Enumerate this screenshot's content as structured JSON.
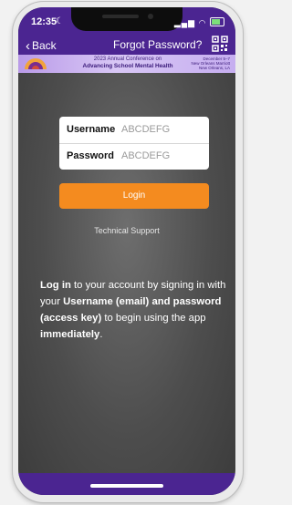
{
  "status_bar": {
    "time": "12:35",
    "moon": "☾",
    "signal": "▂▄▆",
    "wifi": "◠"
  },
  "nav": {
    "back_label": "Back",
    "title": "Forgot Password?"
  },
  "banner": {
    "line1": "2023 Annual Conference on",
    "line2": "Advancing School Mental Health",
    "dates_line1": "December 5–7",
    "dates_line2": "New Orleans Marriott",
    "dates_line3": "New Orleans, LA"
  },
  "form": {
    "username_label": "Username",
    "username_placeholder": "ABCDEFG",
    "password_label": "Password",
    "password_placeholder": "ABCDEFG",
    "login_label": "Login"
  },
  "support_link": "Technical Support",
  "info": {
    "part1": "Log in",
    "part2": " to your account by signing in with your ",
    "part3": "Username (email) and password (access key)",
    "part4": " to begin using the app ",
    "part5": "immediately",
    "part6": "."
  },
  "colors": {
    "brand_purple": "#4b2591",
    "login_orange": "#f48b1f",
    "banner_lavender": "#c6aef0"
  }
}
